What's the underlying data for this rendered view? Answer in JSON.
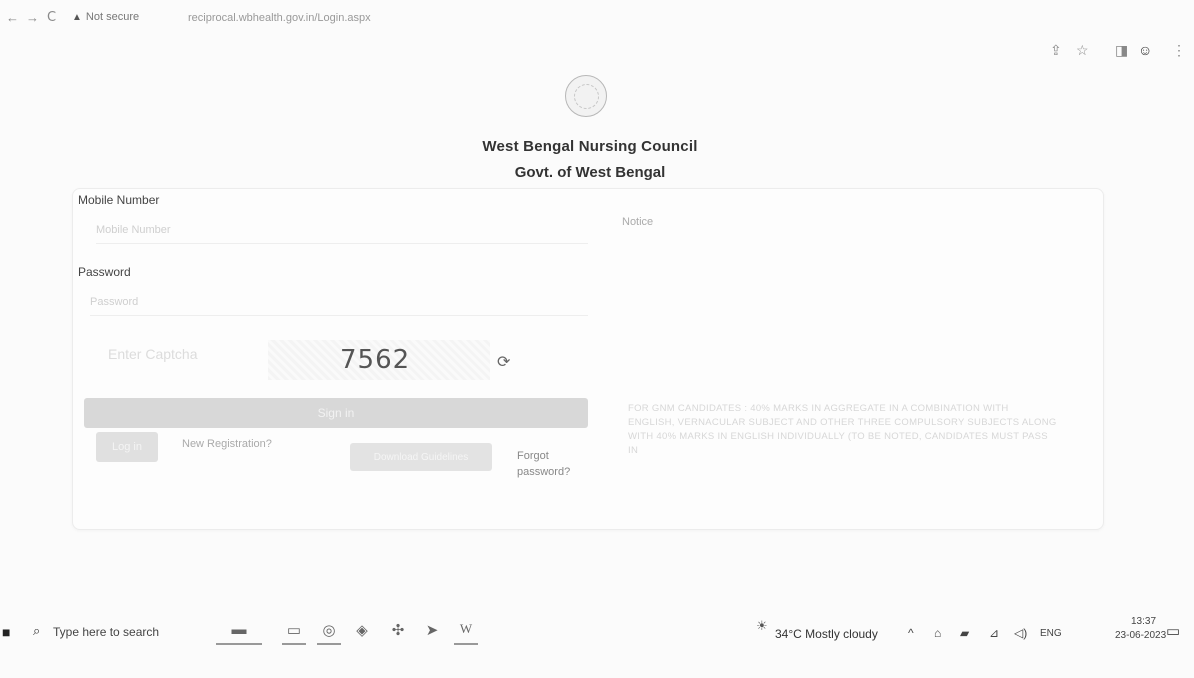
{
  "browser": {
    "back": "←",
    "forward": "→",
    "reload": "C",
    "warning": "Not secure",
    "url": "reciprocal.wbhealth.gov.in/Login.aspx",
    "icons": {
      "share": "⇪",
      "star": "☆",
      "sidebar": "◨",
      "profile": "☺",
      "menu": "⋮"
    }
  },
  "header": {
    "org_name": "West Bengal Nursing Council",
    "org_sub": "Govt. of West Bengal"
  },
  "form": {
    "mobile_label": "Mobile Number",
    "mobile_placeholder": "Mobile Number",
    "password_label": "Password",
    "password_placeholder": "Password",
    "captcha_placeholder": "Enter Captcha",
    "captcha_value": "7562",
    "refresh": "⟳",
    "signin": "Sign in",
    "login": "Log in",
    "new_registration": "New Registration?",
    "download": "Download Guidelines",
    "forgot": "Forgot password?"
  },
  "notice": {
    "label": "Notice",
    "text": "FOR GNM CANDIDATES : 40% MARKS IN AGGREGATE IN A COMBINATION WITH ENGLISH, VERNACULAR SUBJECT AND OTHER THREE COMPULSORY SUBJECTS ALONG WITH 40% MARKS IN ENGLISH INDIVIDUALLY (TO BE NOTED, CANDIDATES MUST PASS IN"
  },
  "taskbar": {
    "windows_icon": "■",
    "search_icon": "⌕",
    "search_placeholder": "Type here to search",
    "apps": [
      "▬",
      "▭",
      "◎",
      "◈",
      "✣",
      "➤",
      "W"
    ],
    "weather": "34°C  Mostly cloudy",
    "tray_icons": [
      "^",
      "⌂",
      "▰",
      "⊿",
      "◁)"
    ],
    "lang": "ENG",
    "time": "13:37",
    "date": "23-06-2023",
    "notifications": "▭"
  }
}
